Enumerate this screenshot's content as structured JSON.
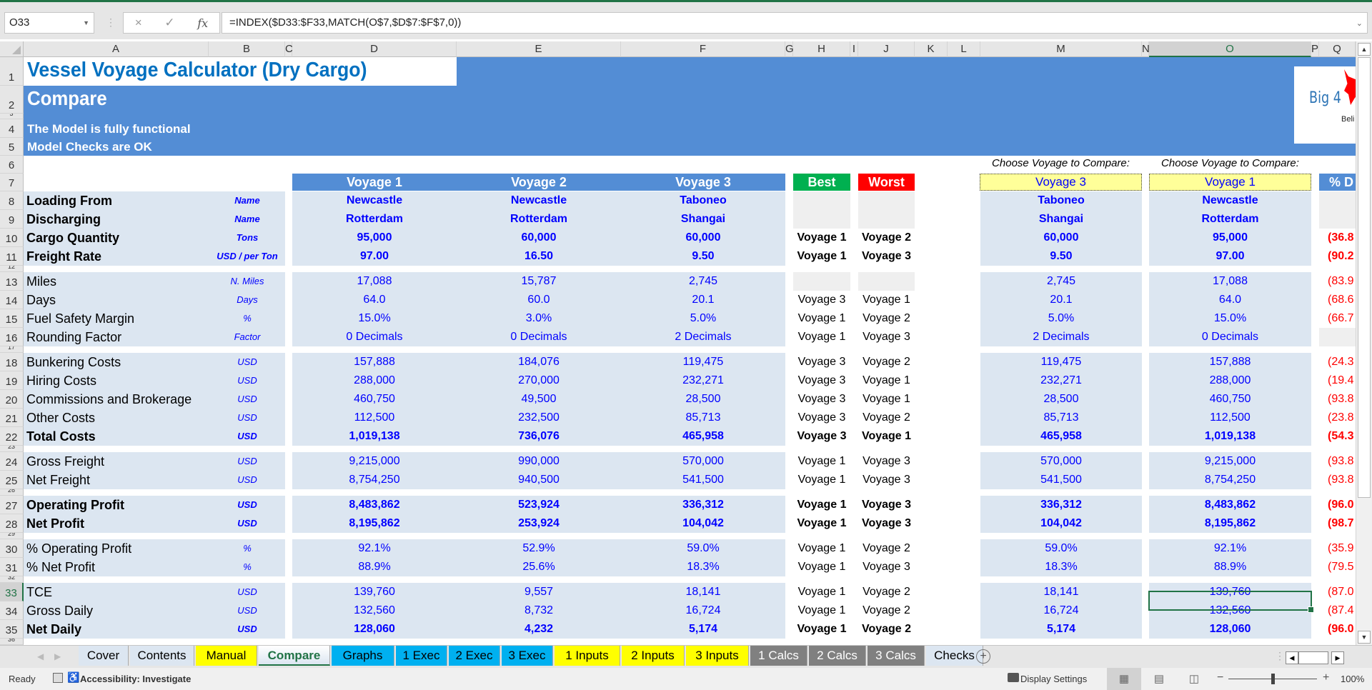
{
  "formula_bar": {
    "name_box": "O33",
    "formula": "=INDEX($D33:$F33,MATCH(O$7,$D$7:$F$7,0))",
    "cancel_icon": "×",
    "enter_icon": "✓",
    "fx_label": "fx"
  },
  "columns": [
    "A",
    "B",
    "C",
    "D",
    "E",
    "F",
    "G",
    "H",
    "I",
    "J",
    "K",
    "L",
    "M",
    "N",
    "O",
    "P",
    "Q"
  ],
  "selected_column": "O",
  "selected_row": "33",
  "header": {
    "title": "Vessel Voyage Calculator (Dry Cargo)",
    "subtitle": "Compare",
    "status_line_1": "The Model is fully functional",
    "status_line_2": "Model Checks are OK",
    "logo_text": "Big 4",
    "logo_subtext": "Beli"
  },
  "table": {
    "voyage_headers": [
      "Voyage 1",
      "Voyage 2",
      "Voyage 3"
    ],
    "best_label": "Best",
    "worst_label": "Worst",
    "choose_label": "Choose Voyage to Compare:",
    "compare_selection_1": "Voyage 3",
    "compare_selection_2": "Voyage 1",
    "pct_diff_header": "% D",
    "rows": [
      {
        "row": "8",
        "label": "Loading From",
        "unit": "Name",
        "bold": true,
        "values": [
          "Newcastle",
          "Newcastle",
          "Taboneo"
        ],
        "best": "",
        "worst": "",
        "cmp1": "Taboneo",
        "cmp2": "Newcastle",
        "pct": ""
      },
      {
        "row": "9",
        "label": "Discharging",
        "unit": "Name",
        "bold": true,
        "values": [
          "Rotterdam",
          "Rotterdam",
          "Shangai"
        ],
        "best": "",
        "worst": "",
        "cmp1": "Shangai",
        "cmp2": "Rotterdam",
        "pct": ""
      },
      {
        "row": "10",
        "label": "Cargo Quantity",
        "unit": "Tons",
        "bold": true,
        "values": [
          "95,000",
          "60,000",
          "60,000"
        ],
        "best": "Voyage 1",
        "worst": "Voyage 2",
        "cmp1": "60,000",
        "cmp2": "95,000",
        "pct": "(36.8"
      },
      {
        "row": "11",
        "label": "Freight Rate",
        "unit": "USD / per Ton",
        "bold": true,
        "values": [
          "97.00",
          "16.50",
          "9.50"
        ],
        "best": "Voyage 1",
        "worst": "Voyage 3",
        "cmp1": "9.50",
        "cmp2": "97.00",
        "pct": "(90.2"
      },
      {
        "row": "13",
        "label": "Miles",
        "unit": "N. Miles",
        "bold": false,
        "values": [
          "17,088",
          "15,787",
          "2,745"
        ],
        "best": "",
        "worst": "",
        "cmp1": "2,745",
        "cmp2": "17,088",
        "pct": "(83.9"
      },
      {
        "row": "14",
        "label": "Days",
        "unit": "Days",
        "bold": false,
        "values": [
          "64.0",
          "60.0",
          "20.1"
        ],
        "best": "Voyage 3",
        "worst": "Voyage 1",
        "cmp1": "20.1",
        "cmp2": "64.0",
        "pct": "(68.6"
      },
      {
        "row": "15",
        "label": "Fuel Safety Margin",
        "unit": "%",
        "bold": false,
        "values": [
          "15.0%",
          "3.0%",
          "5.0%"
        ],
        "best": "Voyage 1",
        "worst": "Voyage 2",
        "cmp1": "5.0%",
        "cmp2": "15.0%",
        "pct": "(66.7"
      },
      {
        "row": "16",
        "label": "Rounding Factor",
        "unit": "Factor",
        "bold": false,
        "values": [
          "0 Decimals",
          "0 Decimals",
          "2 Decimals"
        ],
        "best": "Voyage 1",
        "worst": "Voyage 3",
        "cmp1": "2 Decimals",
        "cmp2": "0 Decimals",
        "pct": ""
      },
      {
        "row": "18",
        "label": "Bunkering Costs",
        "unit": "USD",
        "bold": false,
        "values": [
          "157,888",
          "184,076",
          "119,475"
        ],
        "best": "Voyage 3",
        "worst": "Voyage 2",
        "cmp1": "119,475",
        "cmp2": "157,888",
        "pct": "(24.3"
      },
      {
        "row": "19",
        "label": "Hiring Costs",
        "unit": "USD",
        "bold": false,
        "values": [
          "288,000",
          "270,000",
          "232,271"
        ],
        "best": "Voyage 3",
        "worst": "Voyage 1",
        "cmp1": "232,271",
        "cmp2": "288,000",
        "pct": "(19.4"
      },
      {
        "row": "20",
        "label": "Commissions and Brokerage",
        "unit": "USD",
        "bold": false,
        "values": [
          "460,750",
          "49,500",
          "28,500"
        ],
        "best": "Voyage 3",
        "worst": "Voyage 1",
        "cmp1": "28,500",
        "cmp2": "460,750",
        "pct": "(93.8"
      },
      {
        "row": "21",
        "label": "Other Costs",
        "unit": "USD",
        "bold": false,
        "values": [
          "112,500",
          "232,500",
          "85,713"
        ],
        "best": "Voyage 3",
        "worst": "Voyage 2",
        "cmp1": "85,713",
        "cmp2": "112,500",
        "pct": "(23.8"
      },
      {
        "row": "22",
        "label": "Total Costs",
        "unit": "USD",
        "bold": true,
        "values": [
          "1,019,138",
          "736,076",
          "465,958"
        ],
        "best": "Voyage 3",
        "worst": "Voyage 1",
        "cmp1": "465,958",
        "cmp2": "1,019,138",
        "pct": "(54.3"
      },
      {
        "row": "24",
        "label": "Gross Freight",
        "unit": "USD",
        "bold": false,
        "values": [
          "9,215,000",
          "990,000",
          "570,000"
        ],
        "best": "Voyage 1",
        "worst": "Voyage 3",
        "cmp1": "570,000",
        "cmp2": "9,215,000",
        "pct": "(93.8"
      },
      {
        "row": "25",
        "label": "Net Freight",
        "unit": "USD",
        "bold": false,
        "values": [
          "8,754,250",
          "940,500",
          "541,500"
        ],
        "best": "Voyage 1",
        "worst": "Voyage 3",
        "cmp1": "541,500",
        "cmp2": "8,754,250",
        "pct": "(93.8"
      },
      {
        "row": "27",
        "label": "Operating Profit",
        "unit": "USD",
        "bold": true,
        "values": [
          "8,483,862",
          "523,924",
          "336,312"
        ],
        "best": "Voyage 1",
        "worst": "Voyage 3",
        "cmp1": "336,312",
        "cmp2": "8,483,862",
        "pct": "(96.0"
      },
      {
        "row": "28",
        "label": "Net Profit",
        "unit": "USD",
        "bold": true,
        "values": [
          "8,195,862",
          "253,924",
          "104,042"
        ],
        "best": "Voyage 1",
        "worst": "Voyage 3",
        "cmp1": "104,042",
        "cmp2": "8,195,862",
        "pct": "(98.7"
      },
      {
        "row": "30",
        "label": "% Operating Profit",
        "unit": "%",
        "bold": false,
        "values": [
          "92.1%",
          "52.9%",
          "59.0%"
        ],
        "best": "Voyage 1",
        "worst": "Voyage 2",
        "cmp1": "59.0%",
        "cmp2": "92.1%",
        "pct": "(35.9"
      },
      {
        "row": "31",
        "label": "% Net Profit",
        "unit": "%",
        "bold": false,
        "values": [
          "88.9%",
          "25.6%",
          "18.3%"
        ],
        "best": "Voyage 1",
        "worst": "Voyage 3",
        "cmp1": "18.3%",
        "cmp2": "88.9%",
        "pct": "(79.5"
      },
      {
        "row": "33",
        "label": "TCE",
        "unit": "USD",
        "bold": false,
        "values": [
          "139,760",
          "9,557",
          "18,141"
        ],
        "best": "Voyage 1",
        "worst": "Voyage 2",
        "cmp1": "18,141",
        "cmp2": "139,760",
        "pct": "(87.0"
      },
      {
        "row": "34",
        "label": "Gross Daily",
        "unit": "USD",
        "bold": false,
        "values": [
          "132,560",
          "8,732",
          "16,724"
        ],
        "best": "Voyage 1",
        "worst": "Voyage 2",
        "cmp1": "16,724",
        "cmp2": "132,560",
        "pct": "(87.4"
      },
      {
        "row": "35",
        "label": "Net Daily",
        "unit": "USD",
        "bold": true,
        "values": [
          "128,060",
          "4,232",
          "5,174"
        ],
        "best": "Voyage 1",
        "worst": "Voyage 2",
        "cmp1": "5,174",
        "cmp2": "128,060",
        "pct": "(96.0"
      }
    ]
  },
  "sheet_tabs": [
    {
      "label": "Cover",
      "color": "#dce6f1",
      "active": false
    },
    {
      "label": "Contents",
      "color": "#dce6f1",
      "active": false
    },
    {
      "label": "Manual",
      "color": "#ffff00",
      "active": false
    },
    {
      "label": "Compare",
      "color": "#ffffff",
      "active": true
    },
    {
      "label": "Graphs",
      "color": "#00b0f0",
      "active": false
    },
    {
      "label": "1 Exec",
      "color": "#00b0f0",
      "active": false
    },
    {
      "label": "2 Exec",
      "color": "#00b0f0",
      "active": false
    },
    {
      "label": "3 Exec",
      "color": "#00b0f0",
      "active": false
    },
    {
      "label": "1 Inputs",
      "color": "#ffff00",
      "active": false
    },
    {
      "label": "2 Inputs",
      "color": "#ffff00",
      "active": false
    },
    {
      "label": "3 Inputs",
      "color": "#ffff00",
      "active": false
    },
    {
      "label": "1 Calcs",
      "color": "#808080",
      "active": false
    },
    {
      "label": "2 Calcs",
      "color": "#808080",
      "active": false
    },
    {
      "label": "3 Calcs",
      "color": "#808080",
      "active": false
    },
    {
      "label": "Checks",
      "color": "#dce6f1",
      "active": false
    }
  ],
  "status_bar": {
    "ready": "Ready",
    "accessibility": "Accessibility: Investigate",
    "display_settings": "Display Settings",
    "zoom": "100%"
  },
  "colors": {
    "banner": "#538dd5",
    "title": "#0070c0",
    "band": "#dce6f1",
    "value_blue": "#0000ff",
    "best_green": "#00b050",
    "worst_red": "#ff0000",
    "compare_yellow": "#ffff99",
    "excel_green": "#217346"
  }
}
